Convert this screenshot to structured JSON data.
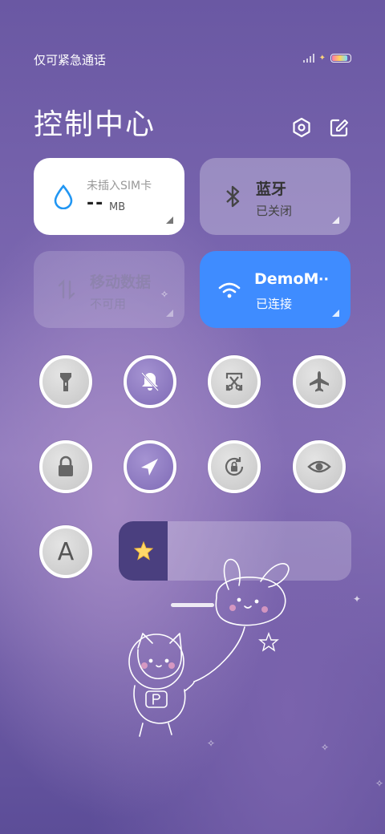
{
  "status_bar": {
    "carrier_text": "仅可紧急通话"
  },
  "header": {
    "title": "控制中心",
    "settings_icon": "gear-icon",
    "edit_icon": "edit-icon"
  },
  "tiles": {
    "data": {
      "line1": "未插入SIM卡",
      "value": "--",
      "unit": "MB",
      "icon": "water-drop-icon"
    },
    "bluetooth": {
      "title": "蓝牙",
      "status": "已关闭",
      "icon": "bluetooth-icon"
    },
    "mobile_data": {
      "title": "移动数据",
      "status": "不可用",
      "icon": "arrows-updown-icon"
    },
    "wifi": {
      "title": "DemoM",
      "ellipsis": "··",
      "status": "已连接",
      "icon": "wifi-icon"
    }
  },
  "toggles": [
    {
      "name": "flashlight",
      "state": "off"
    },
    {
      "name": "mute",
      "state": "on"
    },
    {
      "name": "screenshot",
      "state": "off"
    },
    {
      "name": "airplane",
      "state": "off"
    },
    {
      "name": "lock",
      "state": "off"
    },
    {
      "name": "location",
      "state": "on"
    },
    {
      "name": "auto-rotate",
      "state": "off"
    },
    {
      "name": "reading-mode",
      "state": "off"
    },
    {
      "name": "font-size",
      "label": "A",
      "state": "off"
    }
  ],
  "brightness": {
    "level": 0.21,
    "icon": "star-icon"
  },
  "colors": {
    "wifi_tile": "#3f8cff",
    "tile_white": "#ffffff",
    "tile_glass": "rgba(255,255,255,0.28)",
    "slider_fill": "#4a3f7f"
  }
}
